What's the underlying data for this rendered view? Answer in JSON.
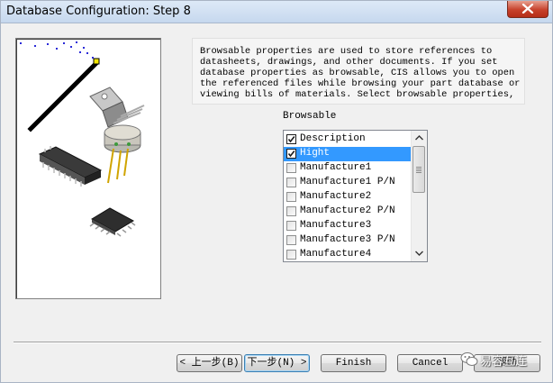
{
  "window": {
    "title": "Database Configuration: Step 8"
  },
  "info": {
    "text": "Browsable properties are used to store references to\ndatasheets, drawings, and other documents. If you set\ndatabase properties as browsable, CIS allows you to open\nthe referenced files while browsing your part database or\nviewing bills of materials. Select browsable properties,"
  },
  "browsable": {
    "label": "Browsable",
    "items": [
      {
        "label": "Description",
        "checked": true,
        "selected": false
      },
      {
        "label": "Hight",
        "checked": true,
        "selected": true
      },
      {
        "label": "Manufacture1",
        "checked": false,
        "selected": false
      },
      {
        "label": "Manufacture1 P/N",
        "checked": false,
        "selected": false
      },
      {
        "label": "Manufacture2",
        "checked": false,
        "selected": false
      },
      {
        "label": "Manufacture2 P/N",
        "checked": false,
        "selected": false
      },
      {
        "label": "Manufacture3",
        "checked": false,
        "selected": false
      },
      {
        "label": "Manufacture3 P/N",
        "checked": false,
        "selected": false
      },
      {
        "label": "Manufacture4",
        "checked": false,
        "selected": false
      }
    ]
  },
  "buttons": {
    "back": "< 上一步(B)",
    "next": "下一步(N) >",
    "finish": "Finish",
    "cancel": "Cancel",
    "help": "帮助"
  },
  "watermark": {
    "text": "易容互连"
  },
  "colors": {
    "selection": "#3399ff",
    "close_button": "#c7412b",
    "titlebar": "#dde9f7"
  }
}
